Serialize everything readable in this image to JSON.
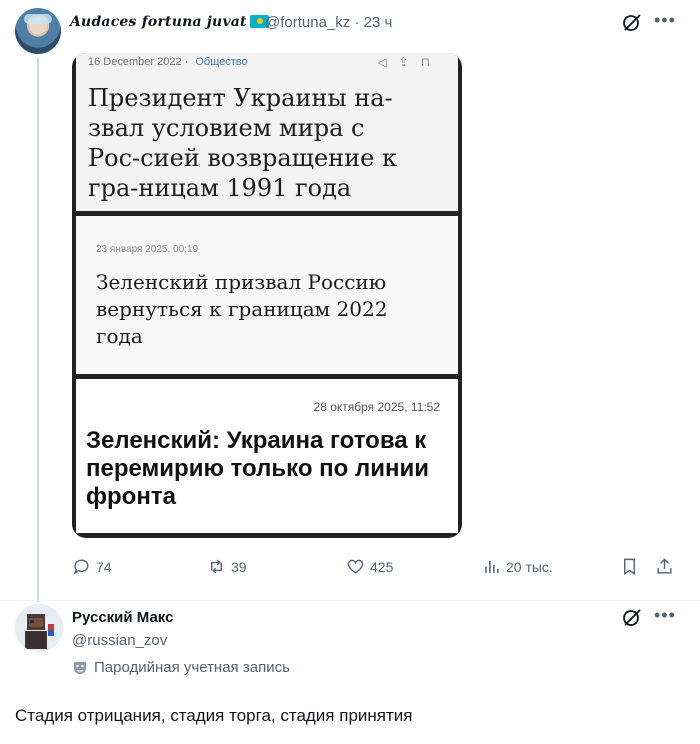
{
  "tweet1": {
    "display_name": "Audaces fortuna juvat",
    "handle": "@fortuna_kz",
    "time": "· 23 ч",
    "media": {
      "card1": {
        "date": "16 December 2022",
        "separator": "·",
        "category": "Общество",
        "headline": "Президент Украины на-звал условием мира с Рос-сией возвращение к гра-ницам 1991 года"
      },
      "card2": {
        "date": "23 января 2025, 00:19",
        "headline": "Зеленский призвал Россию вернуться к границам 2022 года"
      },
      "card3": {
        "date": "28 октября 2025, 11:52",
        "headline": "Зеленский: Украина готова к перемирию только по линии фронта"
      }
    },
    "actions": {
      "replies": "74",
      "reposts": "39",
      "likes": "425",
      "views": "20 тыс."
    }
  },
  "tweet2": {
    "display_name": "Русский Макс",
    "handle": "@russian_zov",
    "parody_label": "Пародийная учетная запись",
    "text": "Стадия отрицания, стадия торга, стадия принятия"
  },
  "colors": {
    "text_primary": "#0f1419",
    "text_secondary": "#536471",
    "kz_flag": "#00afca",
    "divider": "#eff3f4"
  }
}
